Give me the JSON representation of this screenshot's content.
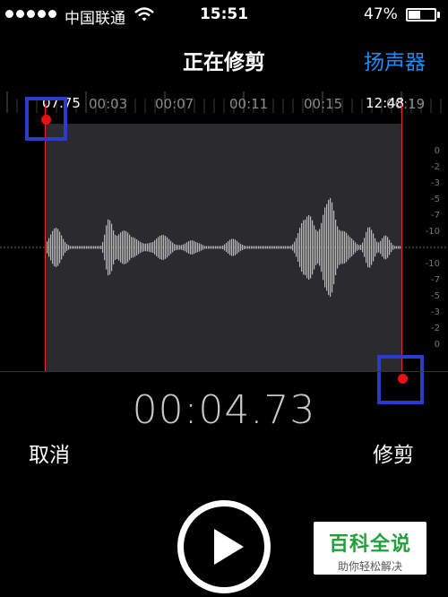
{
  "status_bar": {
    "carrier": "中国联通",
    "time": "15:51",
    "battery_percent": "47%",
    "battery_level": 0.47,
    "signal_bars": 5
  },
  "nav": {
    "title": "正在修剪",
    "speaker_button": "扬声器"
  },
  "timeline": {
    "start_label": "07.75",
    "end_label": "12:48",
    "ticks": [
      "00:03",
      "00:07",
      "00:11",
      "00:15",
      "00:19"
    ]
  },
  "waveform": {
    "db_scale": [
      "0",
      "-2",
      "-3",
      "-5",
      "-7",
      "-10",
      "-10",
      "-7",
      "-5",
      "-3",
      "-2",
      "0"
    ],
    "colors": {
      "selection": "#2b2b2f",
      "trim_line": "#e02a2a",
      "handle_box": "#2a3cc9"
    }
  },
  "playback": {
    "elapsed": "00:04.73"
  },
  "actions": {
    "cancel": "取消",
    "trim": "修剪"
  },
  "watermark": {
    "title": "百科全说",
    "subtitle": "助你轻松解决"
  }
}
